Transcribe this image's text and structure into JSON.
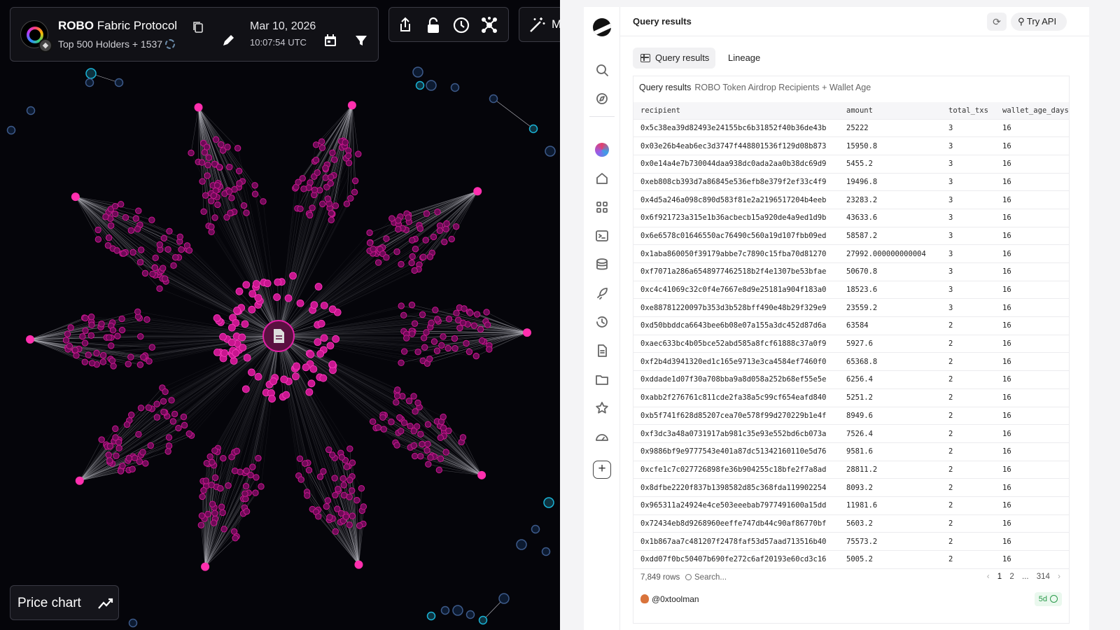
{
  "graph": {
    "title_bold": "ROBO",
    "title_rest": "Fabric Protocol",
    "subtitle": "Top 500 Holders + 1537",
    "date": "Mar 10, 2026",
    "time": "10:07:54 UTC",
    "magic_label": "M",
    "price_chart_label": "Price chart",
    "icons": [
      "copy-icon",
      "edit-icon",
      "calendar-icon",
      "filter-icon",
      "share-icon",
      "lock-icon",
      "clock-icon",
      "network-icon",
      "magic-wand-icon",
      "trend-icon",
      "document-icon"
    ],
    "colors": {
      "background": "#05050a",
      "node": "#c8168f",
      "edge": "#b8b8c0",
      "accent_teal": "#1ab3d6"
    }
  },
  "query": {
    "header_title": "Query results",
    "try_api_label": "Try API",
    "tabs": [
      {
        "label": "Query results",
        "active": true
      },
      {
        "label": "Lineage",
        "active": false
      }
    ],
    "caption_title": "Query results",
    "caption_subtitle": "ROBO Token Airdrop Recipients + Wallet Age",
    "columns": [
      "recipient",
      "amount",
      "total_txs",
      "wallet_age_days"
    ],
    "rows": [
      [
        "0x5c38ea39d82493e24155bc6b31852f40b36de43b",
        "25222",
        "3",
        "16"
      ],
      [
        "0x03e26b4eab6ec3d3747f448801536f129d08b873",
        "15950.8",
        "3",
        "16"
      ],
      [
        "0x0e14a4e7b730044daa938dc0ada2aa0b38dc69d9",
        "5455.2",
        "3",
        "16"
      ],
      [
        "0xeb808cb393d7a86845e536efb8e379f2ef33c4f9",
        "19496.8",
        "3",
        "16"
      ],
      [
        "0x4d5a246a098c890d583f81e2a2196517204b4eeb",
        "23283.2",
        "3",
        "16"
      ],
      [
        "0x6f921723a315e1b36acbecb15a920de4a9ed1d9b",
        "43633.6",
        "3",
        "16"
      ],
      [
        "0x6e6578c01646550ac76490c560a19d107fbb09ed",
        "58587.2",
        "3",
        "16"
      ],
      [
        "0x1aba860050f39179abbe7c7890c15fba70d81270",
        "27992.000000000004",
        "3",
        "16"
      ],
      [
        "0xf7071a286a6548977462518b2f4e1307be53bfae",
        "50670.8",
        "3",
        "16"
      ],
      [
        "0xc4c41069c32c0f4e7667e8d9e25181a904f183a0",
        "18523.6",
        "3",
        "16"
      ],
      [
        "0xe88781220097b353d3b528bff490e48b29f329e9",
        "23559.2",
        "3",
        "16"
      ],
      [
        "0xd50bbddca6643bee6b08e07a155a3dc452d87d6a",
        "63584",
        "2",
        "16"
      ],
      [
        "0xaec633bc4b05bce52abd585a8fcf61888c37a0f9",
        "5927.6",
        "2",
        "16"
      ],
      [
        "0xf2b4d3941320ed1c165e9713e3ca4584ef7460f0",
        "65368.8",
        "2",
        "16"
      ],
      [
        "0xddade1d07f30a708bba9a8d058a252b68ef55e5e",
        "6256.4",
        "2",
        "16"
      ],
      [
        "0xabb2f276761c811cde2fa38a5c99cf654eafd840",
        "5251.2",
        "2",
        "16"
      ],
      [
        "0xb5f741f628d85207cea70e578f99d270229b1e4f",
        "8949.6",
        "2",
        "16"
      ],
      [
        "0xf3dc3a48a0731917ab981c35e93e552bd6cb073a",
        "7526.4",
        "2",
        "16"
      ],
      [
        "0x9886bf9e9777543e401a87dc51342160110e5d76",
        "9581.6",
        "2",
        "16"
      ],
      [
        "0xcfe1c7c027726898fe36b904255c18bfe2f7a8ad",
        "28811.2",
        "2",
        "16"
      ],
      [
        "0x8dfbe2220f837b1398582d85c368fda119902254",
        "8093.2",
        "2",
        "16"
      ],
      [
        "0x965311a24924e4ce503eeebab7977491600a15dd",
        "11981.6",
        "2",
        "16"
      ],
      [
        "0x72434eb8d9268960eeffe747db44c90af86770bf",
        "5603.2",
        "2",
        "16"
      ],
      [
        "0x1b867aa7c481207f2478faf53d57aad713516b40",
        "75573.2",
        "2",
        "16"
      ],
      [
        "0xdd07f0bc50407b690fe272c6af20193e60cd3c16",
        "5005.2",
        "2",
        "16"
      ]
    ],
    "row_count": "7,849 rows",
    "search_placeholder": "Search...",
    "pagination": {
      "prev": "‹",
      "pages": [
        "1",
        "2",
        "...",
        "314"
      ],
      "next": "›",
      "current": "1"
    },
    "author": "@0xtoolman",
    "age_badge": "5d",
    "rail_icons": [
      "logo-icon",
      "search-icon",
      "compass-icon",
      "avatar",
      "home-icon",
      "apps-icon",
      "terminal-icon",
      "database-icon",
      "rocket-icon",
      "history-icon",
      "document-icon",
      "folder-icon",
      "star-icon",
      "dashboard-icon",
      "add-icon"
    ],
    "colors": {
      "panel": "#ffffff",
      "border": "#ececef",
      "badge_green": "#2a9a4a"
    }
  }
}
